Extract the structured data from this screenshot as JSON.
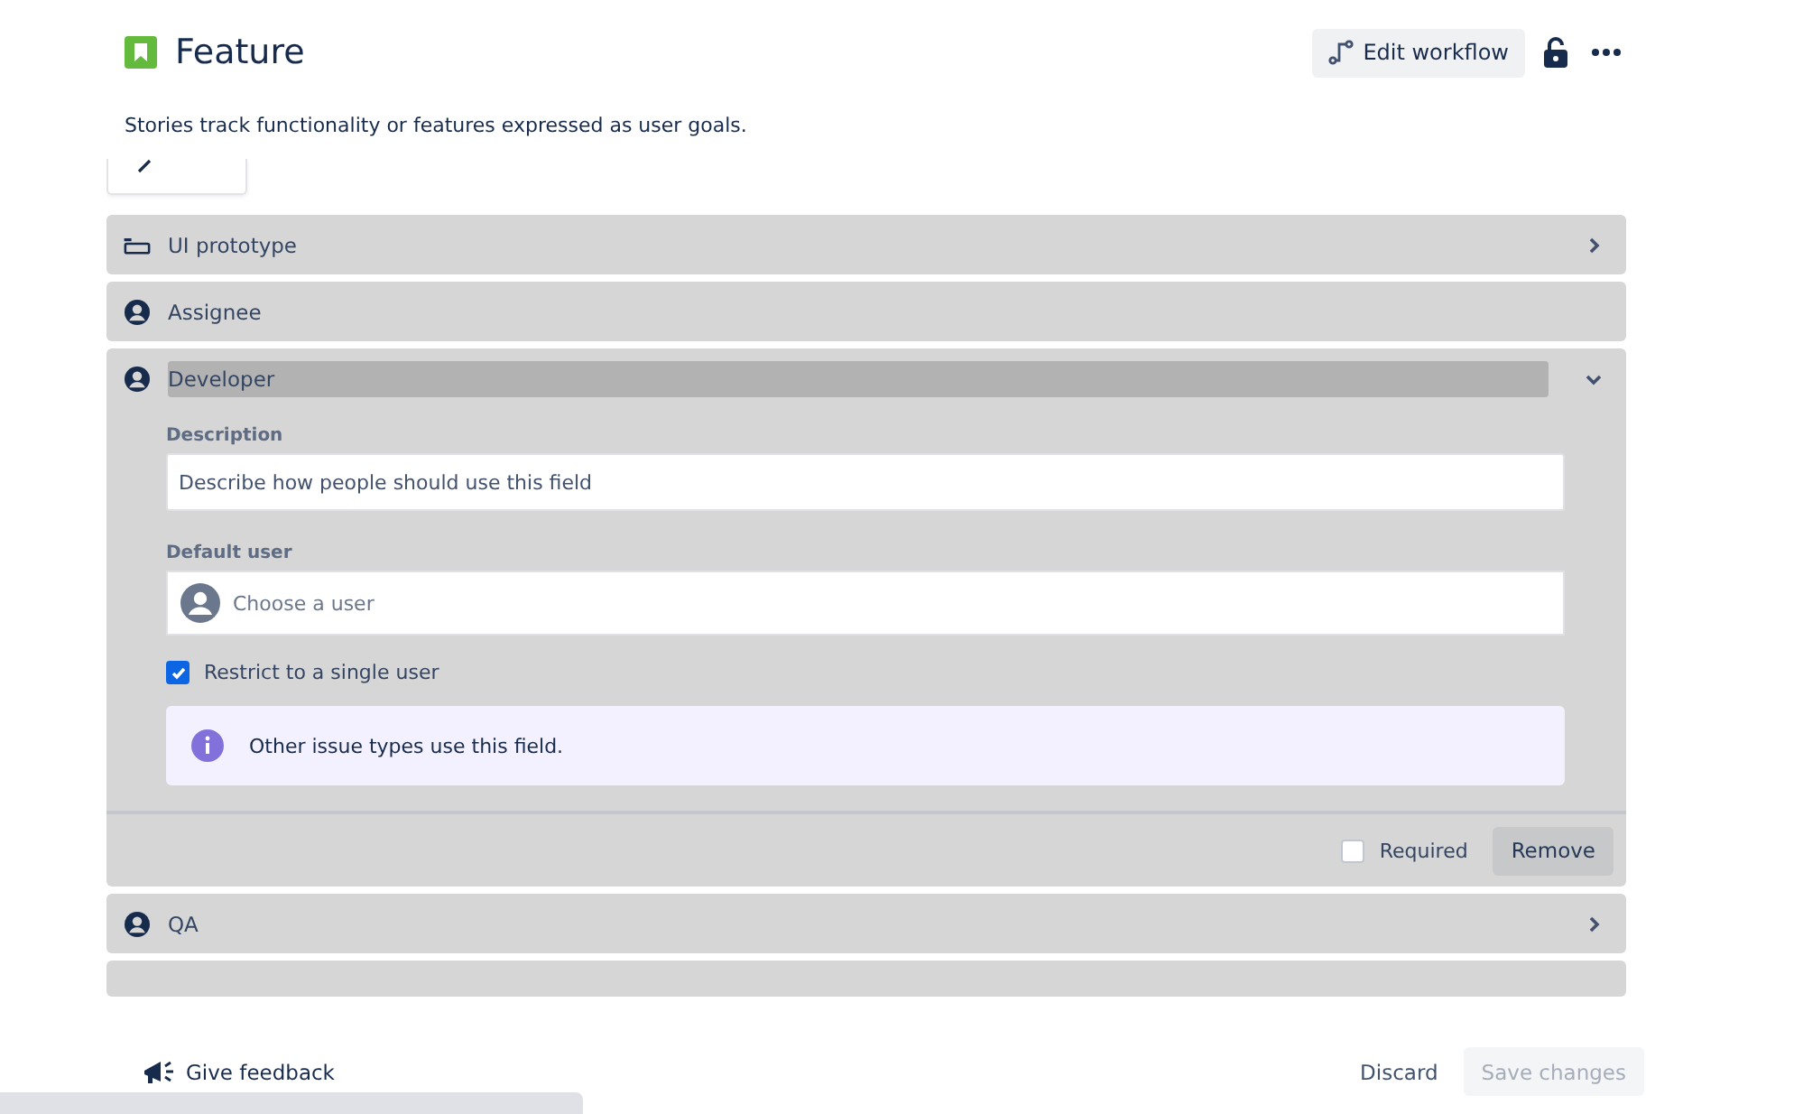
{
  "header": {
    "title": "Feature",
    "edit_button": "Edit workflow",
    "description": "Stories track functionality or features expressed as user goals."
  },
  "fields": [
    {
      "kind": "ui",
      "label": "UI prototype",
      "expandable": true,
      "expanded": false,
      "highlighted": false
    },
    {
      "kind": "user",
      "label": "Assignee",
      "expandable": false,
      "expanded": false,
      "highlighted": false
    },
    {
      "kind": "user",
      "label": "Developer",
      "expandable": true,
      "expanded": true,
      "highlighted": true,
      "details": {
        "description_label": "Description",
        "description_placeholder": "Describe how people should use this field",
        "default_user_label": "Default user",
        "default_user_placeholder": "Choose a user",
        "restrict": {
          "label": "Restrict to a single user",
          "checked": true
        },
        "info": "Other issue types use this field.",
        "required": {
          "label": "Required",
          "checked": false
        },
        "remove_button": "Remove"
      }
    },
    {
      "kind": "user",
      "label": "QA",
      "expandable": true,
      "expanded": false,
      "highlighted": false
    }
  ],
  "footer": {
    "feedback": "Give feedback",
    "discard": "Discard",
    "save": {
      "label": "Save changes",
      "disabled": true
    }
  }
}
